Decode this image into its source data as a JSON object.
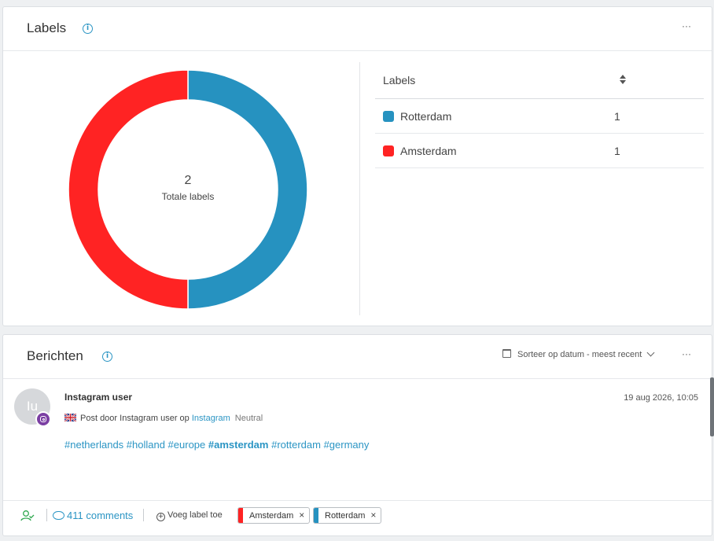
{
  "labels_card": {
    "title": "Labels",
    "more": "···",
    "donut": {
      "total": "2",
      "total_label": "Totale labels",
      "segments": [
        {
          "name": "Rotterdam",
          "value": 1,
          "color": "#2692c0"
        },
        {
          "name": "Amsterdam",
          "value": 1,
          "color": "#ff2323"
        }
      ]
    },
    "table": {
      "header": "Labels",
      "rows": [
        {
          "name": "Rotterdam",
          "count": "1",
          "color": "#2692c0"
        },
        {
          "name": "Amsterdam",
          "count": "1",
          "color": "#ff2323"
        }
      ]
    }
  },
  "posts_card": {
    "title": "Berichten",
    "sort_label": "Sorteer op datum - meest recent",
    "more": "···",
    "post": {
      "avatar_initials": "Iu",
      "author": "Instagram user",
      "date": "19 aug 2026, 10:05",
      "meta_prefix": "Post door Instagram user op",
      "meta_source": "Instagram",
      "sentiment": "Neutral",
      "text_parts": [
        "#netherlands #holland #europe ",
        "#amsterdam",
        " #rotterdam #germany"
      ],
      "comments": "411 comments",
      "add_label": "Voeg label toe",
      "tags": [
        {
          "name": "Amsterdam",
          "color": "#ff2323"
        },
        {
          "name": "Rotterdam",
          "color": "#2692c0"
        }
      ],
      "remove_glyph": "×"
    }
  },
  "icons": [
    "info-icon",
    "more-icon",
    "sort-icon",
    "calendar-icon",
    "chevron-down-icon",
    "instagram-icon",
    "flag-uk-icon",
    "assign-user-icon",
    "comment-icon",
    "plus-circle-icon",
    "close-icon"
  ]
}
